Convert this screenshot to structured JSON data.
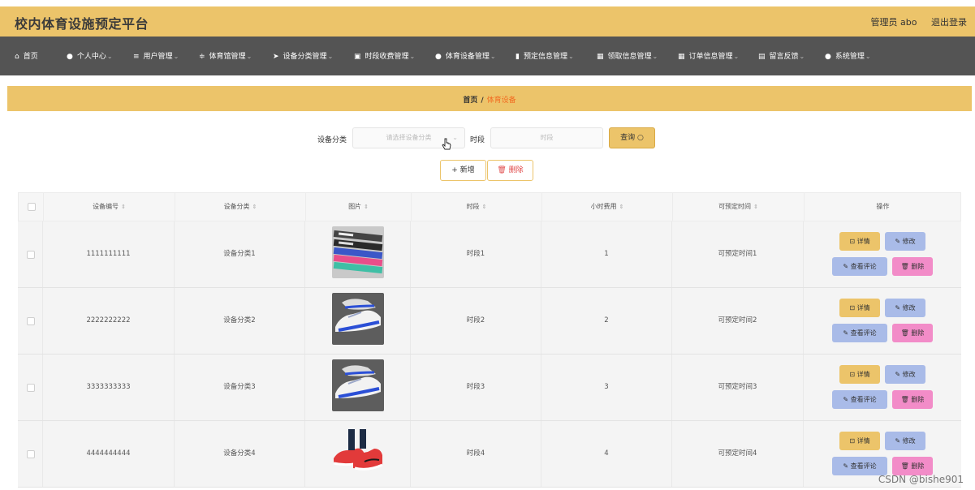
{
  "header": {
    "title": "校内体育设施预定平台",
    "user_label": "管理员 abo",
    "logout_label": "退出登录"
  },
  "nav": {
    "items": [
      {
        "label": "首页",
        "icon": "home-icon",
        "glyph": "⌂"
      },
      {
        "label": "个人中心",
        "icon": "person-icon",
        "glyph": "●"
      },
      {
        "label": "用户管理",
        "icon": "menu-icon",
        "glyph": "≡"
      },
      {
        "label": "体育馆管理",
        "icon": "sliders-icon",
        "glyph": "≑"
      },
      {
        "label": "设备分类管理",
        "icon": "send-icon",
        "glyph": "➤"
      },
      {
        "label": "时段收费管理",
        "icon": "chart-icon",
        "glyph": "▣"
      },
      {
        "label": "体育设备管理",
        "icon": "pin-icon",
        "glyph": "●"
      },
      {
        "label": "预定信息管理",
        "icon": "bar-chart-icon",
        "glyph": "▮"
      },
      {
        "label": "领取信息管理",
        "icon": "grid-icon",
        "glyph": "▦"
      },
      {
        "label": "订单信息管理",
        "icon": "grid-icon",
        "glyph": "▦"
      },
      {
        "label": "留言反馈",
        "icon": "clipboard-icon",
        "glyph": "▤"
      },
      {
        "label": "系统管理",
        "icon": "user-icon",
        "glyph": "●"
      }
    ]
  },
  "breadcrumb": {
    "home": "首页",
    "separator": "/",
    "current": "体育设备"
  },
  "search": {
    "category_label": "设备分类",
    "category_placeholder": "请选择设备分类",
    "period_label": "时段",
    "period_placeholder": "时段",
    "query_label": "查询 ○"
  },
  "actions": {
    "add_label": "+ 新增",
    "delete_label": "🗑 删除"
  },
  "table": {
    "columns": [
      "设备编号",
      "设备分类",
      "图片",
      "时段",
      "小时费用",
      "可预定时间",
      "操作"
    ],
    "sort_glyph": "⇕",
    "rows": [
      {
        "id": "1111111111",
        "category": "设备分类1",
        "image": "resistance-bands",
        "period": "时段1",
        "fee": "1",
        "time": "可预定时间1"
      },
      {
        "id": "2222222222",
        "category": "设备分类2",
        "image": "white-sneaker",
        "period": "时段2",
        "fee": "2",
        "time": "可预定时间2"
      },
      {
        "id": "3333333333",
        "category": "设备分类3",
        "image": "white-sneaker",
        "period": "时段3",
        "fee": "3",
        "time": "可预定时间3"
      },
      {
        "id": "4444444444",
        "category": "设备分类4",
        "image": "red-sneaker",
        "period": "时段4",
        "fee": "4",
        "time": "可预定时间4"
      }
    ],
    "row_actions": {
      "detail": "⊡ 详情",
      "edit": "✎ 修改",
      "review": "✎ 查看评论",
      "delete": "🗑 删除"
    }
  },
  "watermark": "CSDN @bishe901",
  "colors": {
    "accent": "#ecc46a",
    "nav_bg": "#545454",
    "crumb_current": "#f26d22",
    "edit_btn": "#a9bbe8",
    "delete_btn": "#f28cc8"
  }
}
